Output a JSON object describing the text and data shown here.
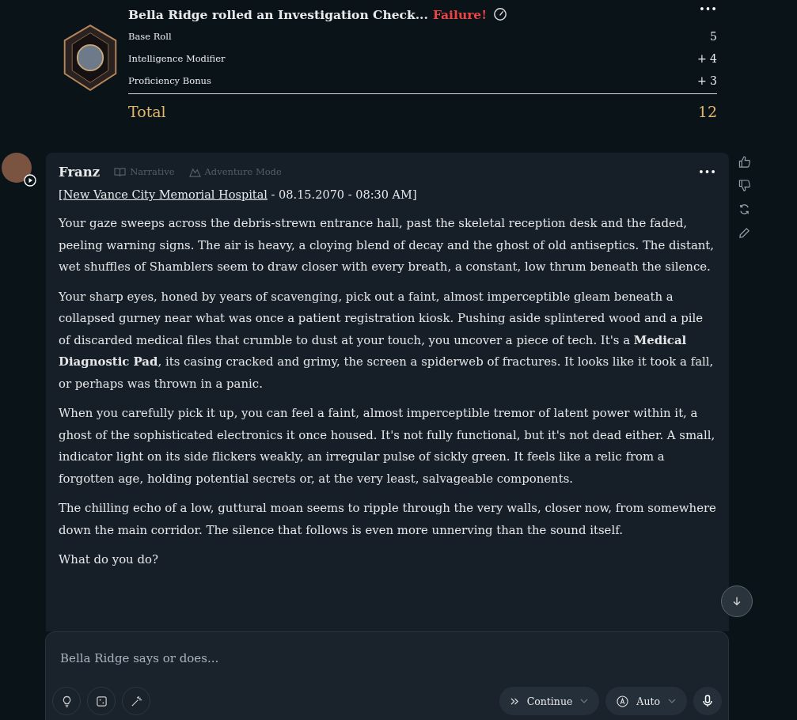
{
  "roll": {
    "title": "Bella Ridge rolled an Investigation Check...",
    "result": {
      "text": "Failure!",
      "kind": "failure"
    },
    "rows": [
      {
        "label": "Base Roll",
        "value": "5"
      },
      {
        "label": "Intelligence Modifier",
        "value": "+ 4"
      },
      {
        "label": "Proficiency Bonus",
        "value": "+ 3"
      }
    ],
    "total": {
      "label": "Total",
      "value": "12"
    }
  },
  "message": {
    "author": "Franz",
    "tags": [
      {
        "kind": "narrative",
        "label": "Narrative"
      },
      {
        "kind": "adventure",
        "label": "Adventure Mode"
      }
    ],
    "location": {
      "link": "[New Vance City Memorial Hospital",
      "rest": " - 08.15.2070 - 08:30 AM]"
    },
    "paragraphs": [
      "Your gaze sweeps across the debris-strewn entrance hall, past the skeletal reception desk and the faded, peeling warning signs. The air is heavy, a cloying blend of decay and the ghost of old antiseptics. The distant, wet shuffles of Shamblers seem to draw closer with every breath, a constant, low thrum beneath the silence.",
      "Your sharp eyes, honed by years of scavenging, pick out a faint, almost imperceptible gleam beneath a collapsed gurney near what was once a patient registration kiosk. Pushing aside splintered wood and a pile of discarded medical files that crumble to dust at your touch, you uncover a piece of tech. It's a **Medical Diagnostic Pad**, its casing cracked and grimy, the screen a spiderweb of fractures. It looks like it took a fall, or perhaps was thrown in a panic.",
      "When you carefully pick it up, you can feel a faint, almost imperceptible tremor of latent power within it, a ghost of the sophisticated electronics it once housed. It's not fully functional, but it's not dead either. A small, indicator light on its side flickers weakly, an irregular pulse of sickly green. It feels like a relic from a forgotten age, holding potential secrets or, at the very least, salvageable components.",
      "The chilling echo of a low, guttural moan seems to ripple through the very walls, closer now, from somewhere down the main corridor. The silence that follows is even more unnerving than the sound itself.",
      "What do you do?"
    ]
  },
  "composer": {
    "placeholder": "Bella Ridge says or does...",
    "continue": "Continue",
    "mode": "Auto"
  }
}
